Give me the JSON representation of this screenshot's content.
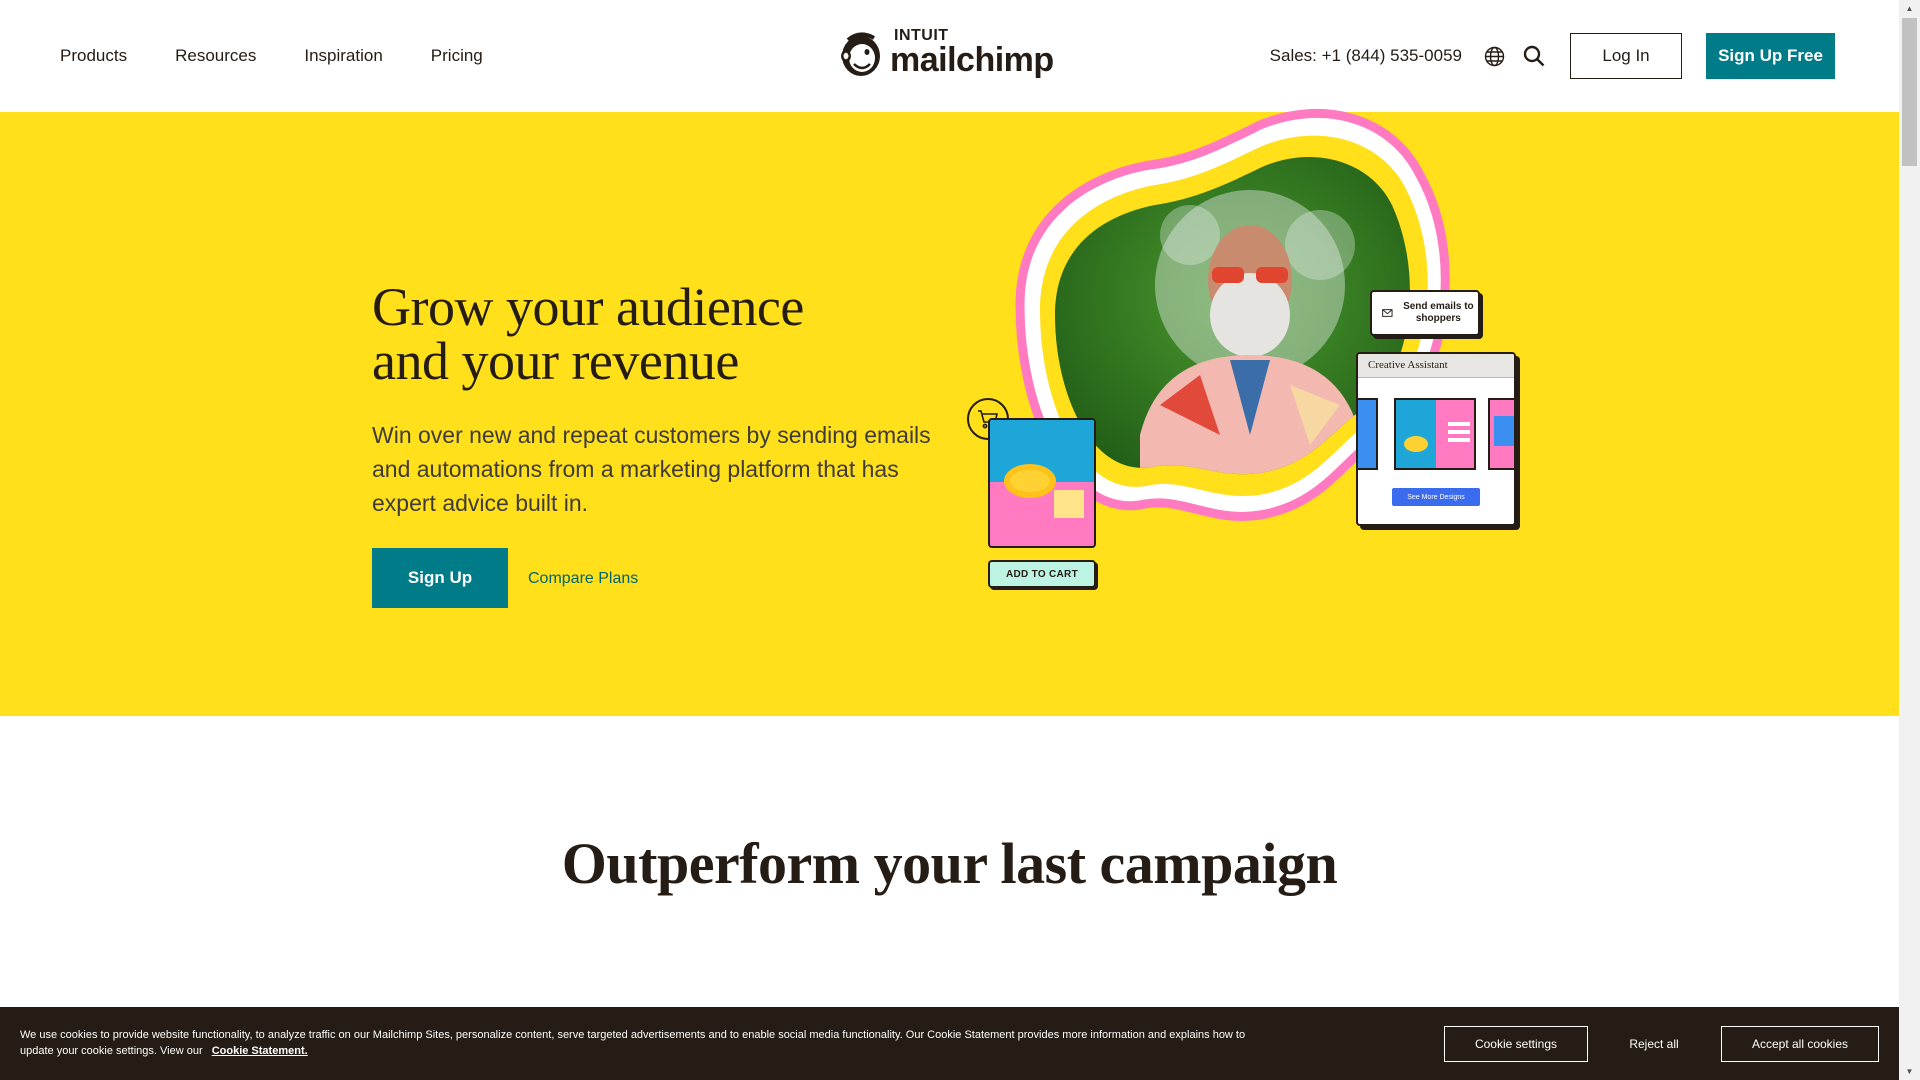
{
  "header": {
    "nav": [
      "Products",
      "Resources",
      "Inspiration",
      "Pricing"
    ],
    "logo_intuit": "INTUIT",
    "logo_main": "mailchimp",
    "sales": "Sales: +1 (844) 535-0059",
    "globe_icon": "globe-icon",
    "search_icon": "search-icon",
    "login": "Log In",
    "signup_free": "Sign Up Free"
  },
  "hero": {
    "title_line1": "Grow your audience",
    "title_line2": "and your revenue",
    "subtitle": "Win over new and repeat customers by sending emails and automations from a marketing platform that has expert advice built in.",
    "signup": "Sign Up",
    "compare": "Compare Plans",
    "art": {
      "send_emails": "Send emails to shoppers",
      "creative_assistant": "Creative Assistant",
      "see_more": "See More Designs",
      "add_to_cart": "ADD TO CART",
      "cart_icon": "cart-icon",
      "envelope_icon": "envelope-icon"
    }
  },
  "section2": {
    "title": "Outperform your last campaign"
  },
  "cookie": {
    "text": "We use cookies to provide website functionality, to analyze traffic on our Mailchimp Sites, personalize content, serve targeted advertisements and to enable social media functionality. Our Cookie Statement provides more information and explains how to update your cookie settings. View our",
    "link": "Cookie Statement.",
    "settings": "Cookie settings",
    "reject": "Reject all",
    "accept": "Accept all cookies"
  },
  "colors": {
    "brand_yellow": "#ffe01b",
    "brand_teal": "#007c89",
    "dark": "#241c15",
    "pink": "#ff7ac1"
  }
}
